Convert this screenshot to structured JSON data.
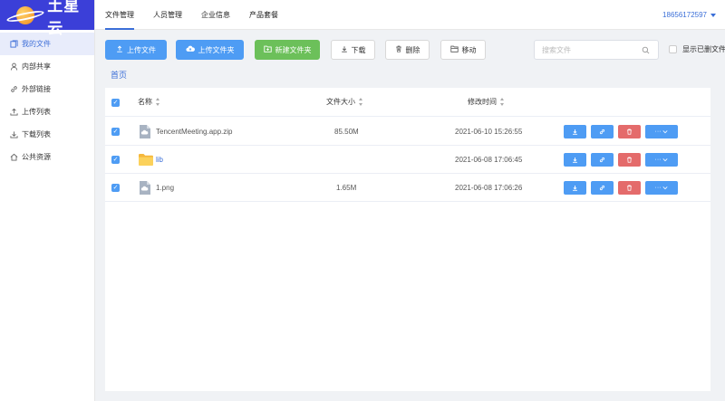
{
  "brand": {
    "name": "土星云"
  },
  "sidebar": {
    "items": [
      {
        "label": "我的文件",
        "icon": "files-icon",
        "active": true
      },
      {
        "label": "内部共享",
        "icon": "user-icon"
      },
      {
        "label": "外部链接",
        "icon": "link-icon"
      },
      {
        "label": "上传列表",
        "icon": "upload-icon"
      },
      {
        "label": "下载列表",
        "icon": "download-icon"
      },
      {
        "label": "公共资源",
        "icon": "home-icon"
      }
    ]
  },
  "header": {
    "tabs": [
      {
        "label": "文件管理",
        "active": true
      },
      {
        "label": "人员管理"
      },
      {
        "label": "企业信息"
      },
      {
        "label": "产品套餐"
      }
    ],
    "user": "18656172597"
  },
  "toolbar": {
    "upload_file": "上传文件",
    "upload_folder": "上传文件夹",
    "new_folder": "新建文件夹",
    "download": "下载",
    "delete": "删除",
    "move": "移动",
    "search_placeholder": "搜索文件",
    "show_deleted": "显示已删文件"
  },
  "breadcrumb": "首页",
  "table": {
    "columns": {
      "name": "名称",
      "size": "文件大小",
      "modified": "修改时间"
    },
    "rows": [
      {
        "name": "TencentMeeting.app.zip",
        "size": "85.50M",
        "modified": "2021-06-10 15:26:55",
        "type": "file",
        "checked": true
      },
      {
        "name": "lib",
        "size": "",
        "modified": "2021-06-08 17:06:45",
        "type": "folder",
        "checked": true
      },
      {
        "name": "1.png",
        "size": "1.65M",
        "modified": "2021-06-08 17:06:26",
        "type": "file",
        "checked": true
      }
    ]
  },
  "colors": {
    "brand": "#3b3fd8",
    "primary": "#4e9cf4",
    "success": "#6cc05a",
    "danger": "#e46b6b",
    "folder": "#f7c342"
  }
}
